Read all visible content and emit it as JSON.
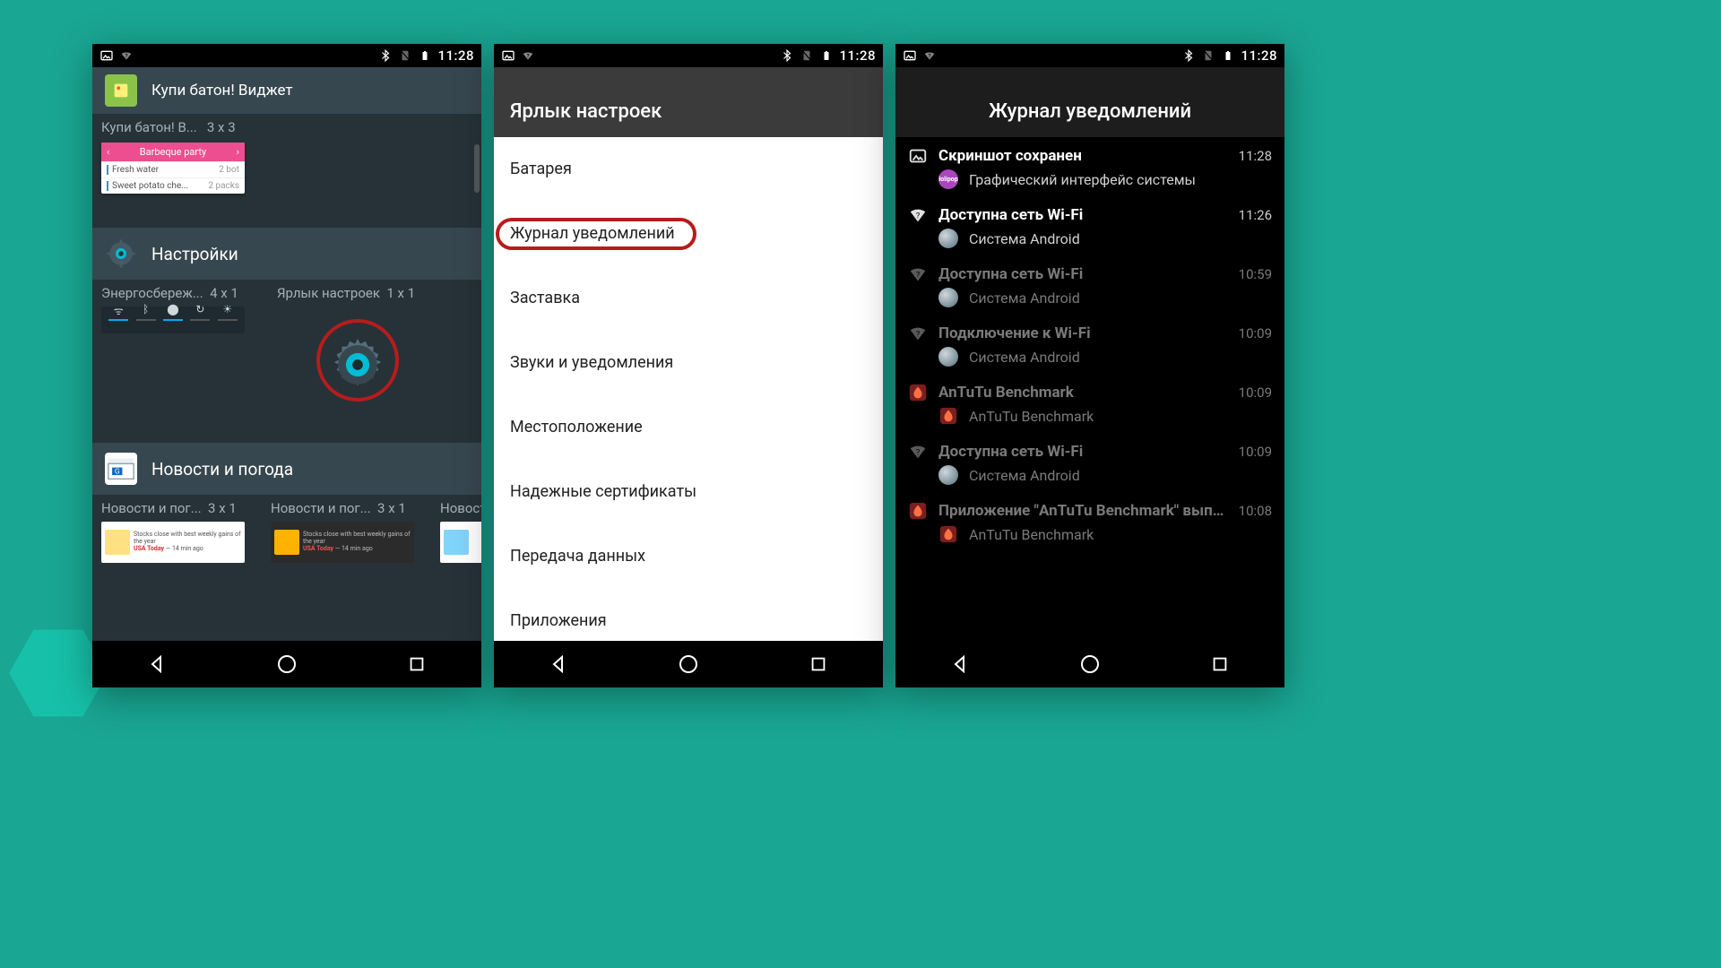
{
  "statusbar": {
    "time": "11:28"
  },
  "screen1": {
    "sec_buy": {
      "title": "Купи батон! Виджет",
      "widget_name": "Купи батон! В...",
      "widget_size": "3 x 3",
      "preview": {
        "title": "Barbeque party",
        "rows": [
          {
            "name": "Fresh water",
            "qty": "2 bot"
          },
          {
            "name": "Sweet potato che...",
            "qty": "2 packs"
          }
        ]
      }
    },
    "sec_settings": {
      "title": "Настройки",
      "w1_name": "Энергосбереж...",
      "w1_size": "4 x 1",
      "w2_name": "Ярлык настроек",
      "w2_size": "1 x 1"
    },
    "sec_news": {
      "title": "Новости и погода",
      "w1_name": "Новости и пог...",
      "w1_size": "3 x 1",
      "w2_name": "Новости и пог...",
      "w2_size": "3 x 1",
      "w3_name": "Новост"
    }
  },
  "screen2": {
    "title": "Ярлык настроек",
    "items": [
      "Батарея",
      "Журнал уведомлений",
      "Заставка",
      "Звуки и уведомления",
      "Местоположение",
      "Надежные сертификаты",
      "Передача данных",
      "Приложения"
    ]
  },
  "screen3": {
    "title": "Журнал уведомлений",
    "items": [
      {
        "title": "Скриншот сохранен",
        "sub": "Графический интерфейс системы",
        "time": "11:28",
        "dim": false,
        "ico": "image",
        "ico2": "lollipop"
      },
      {
        "title": "Доступна сеть Wi-Fi",
        "sub": "Система Android",
        "time": "11:26",
        "dim": false,
        "ico": "wifi-q",
        "ico2": "android"
      },
      {
        "title": "Доступна сеть Wi-Fi",
        "sub": "Система Android",
        "time": "10:59",
        "dim": true,
        "ico": "wifi-q",
        "ico2": "android"
      },
      {
        "title": "Подключение к Wi-Fi",
        "sub": "Система Android",
        "time": "10:09",
        "dim": true,
        "ico": "wifi-q",
        "ico2": "android"
      },
      {
        "title": "AnTuTu Benchmark",
        "sub": "AnTuTu Benchmark",
        "time": "10:09",
        "dim": true,
        "ico": "antutu",
        "ico2": "antutu"
      },
      {
        "title": "Доступна сеть Wi-Fi",
        "sub": "Система Android",
        "time": "10:09",
        "dim": true,
        "ico": "wifi-q",
        "ico2": "android"
      },
      {
        "title": "Приложение \"AnTuTu Benchmark\" выпол...",
        "sub": "AnTuTu Benchmark",
        "time": "10:08",
        "dim": true,
        "ico": "antutu",
        "ico2": "antutu"
      }
    ]
  }
}
